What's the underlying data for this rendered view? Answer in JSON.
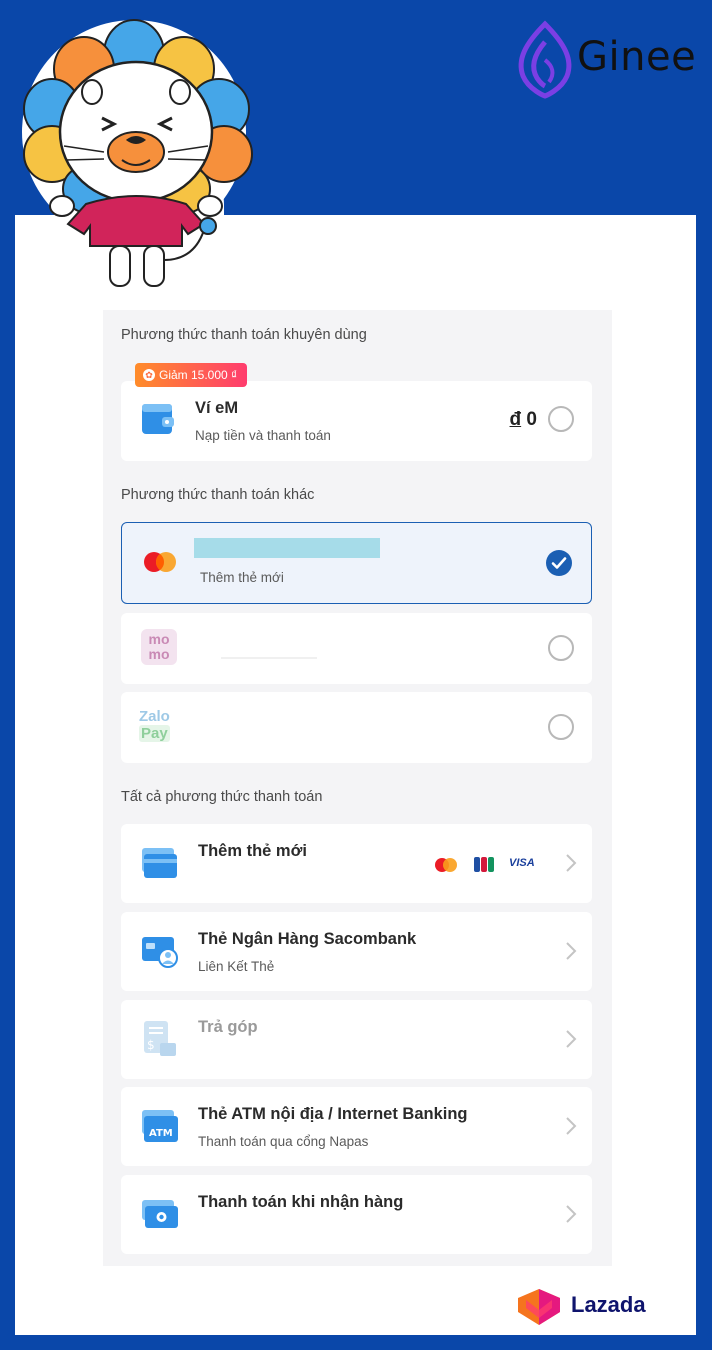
{
  "brand": {
    "name": "Ginee"
  },
  "footer_brand": {
    "name": "Lazada"
  },
  "recommended": {
    "section_title": "Phương thức thanh toán khuyên dùng",
    "badge": "Giảm 15.000 ₫",
    "wallet": {
      "title": "Ví eM",
      "subtitle": "Nạp tiền và thanh toán",
      "currency": "đ",
      "balance": "0"
    }
  },
  "other": {
    "section_title": "Phương thức thanh toán khác",
    "card": {
      "subtitle": "Thêm thẻ mới",
      "selected": true
    },
    "momo": {
      "logo_top": "mo",
      "logo_bottom": "mo"
    },
    "zalopay": {
      "logo_top": "Zalo",
      "logo_bottom": "Pay"
    }
  },
  "all": {
    "section_title": "Tất cả phương thức thanh toán",
    "items": [
      {
        "title": "Thêm thẻ mới",
        "subtitle": "",
        "icon": "card-icon",
        "brands": [
          "mastercard",
          "JCB",
          "VISA"
        ]
      },
      {
        "title": "Thẻ Ngân Hàng Sacombank",
        "subtitle": "Liên Kết Thẻ",
        "icon": "bank-card-user-icon"
      },
      {
        "title": "Trả góp",
        "subtitle": "",
        "icon": "installment-icon",
        "disabled": true
      },
      {
        "title": "Thẻ ATM nội địa / Internet Banking",
        "subtitle": "Thanh toán qua cổng Napas",
        "icon": "atm-icon"
      },
      {
        "title": "Thanh toán khi nhận hàng",
        "subtitle": "",
        "icon": "cash-icon"
      }
    ]
  },
  "colors": {
    "background": "#0a47a9",
    "accent": "#1b5fb3",
    "badge_start": "#ff8c2a",
    "badge_end": "#ff3c6e",
    "icon_blue": "#2f8fe6"
  }
}
